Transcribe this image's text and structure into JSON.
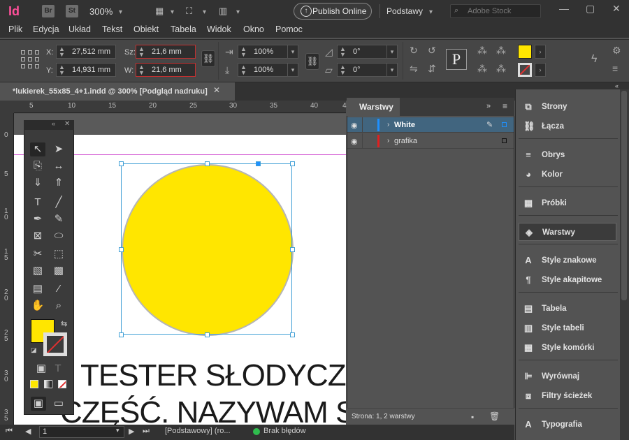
{
  "app": {
    "logo": "Id",
    "bridge": "Br",
    "stock_icon": "St",
    "zoom": "300%",
    "publish_label": "Publish Online",
    "workspace": "Podstawy",
    "search_placeholder": "Adobe Stock"
  },
  "menu": [
    "Plik",
    "Edycja",
    "Układ",
    "Tekst",
    "Obiekt",
    "Tabela",
    "Widok",
    "Okno",
    "Pomoc"
  ],
  "control": {
    "x_label": "X:",
    "x_value": "27,512 mm",
    "y_label": "Y:",
    "y_value": "14,931 mm",
    "w_label": "Sz:",
    "w_value": "21,6 mm",
    "h_label": "W:",
    "h_value": "21,6 mm",
    "scale_x": "100%",
    "scale_y": "100%",
    "rotate": "0°",
    "shear": "0°",
    "accent_fill": "#ffe600"
  },
  "document": {
    "tab_title": "*lukierek_55x85_4+1.indd @ 300% [Podgląd nadruku]",
    "text_line1": "TESTER SŁODYCZY",
    "text_line2": "CZĘŚĆ. NAZYWAM SIĘ",
    "ruler_h": [
      "5",
      "10",
      "15",
      "20",
      "25",
      "30",
      "35",
      "40",
      "45"
    ],
    "ruler_v": [
      "0",
      "5",
      "1\n0",
      "1\n5",
      "2\n0",
      "2\n5",
      "3\n0",
      "3\n5"
    ]
  },
  "layers": {
    "title": "Warstwy",
    "rows": [
      {
        "name": "White",
        "color": "#1e90ff",
        "selected": true
      },
      {
        "name": "grafika",
        "color": "#e02020",
        "selected": false
      }
    ],
    "status": "Strona: 1, 2 warstwy"
  },
  "right_panels": [
    "Strony",
    "Łącza",
    "Obrys",
    "Kolor",
    "Próbki",
    "Warstwy",
    "Style znakowe",
    "Style akapitowe",
    "Tabela",
    "Style tabeli",
    "Style komórki",
    "Wyrównaj",
    "Filtry ścieżek",
    "Typografia"
  ],
  "status_bar": {
    "page": "1",
    "profile": "[Podstawowy] (ro...",
    "errors": "Brak błędów"
  }
}
